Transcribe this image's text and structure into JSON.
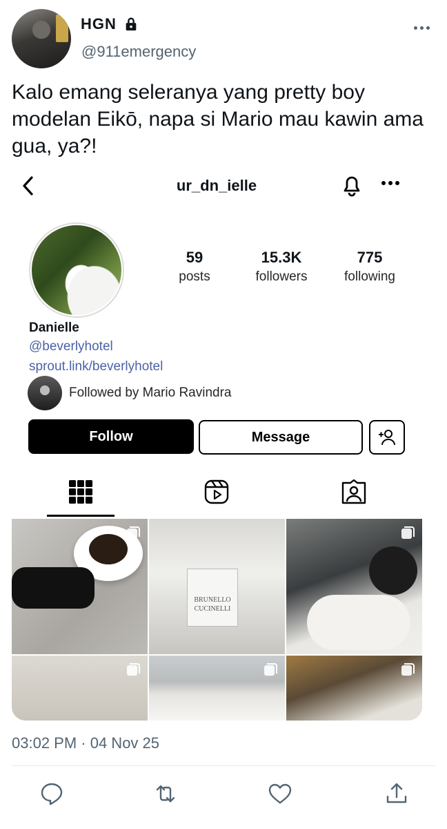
{
  "tweet": {
    "author_name": "HGN",
    "author_handle": "@911emergency",
    "text": "Kalo emang seleranya yang pretty boy modelan Eikō, napa si Mario mau kawin ama gua, ya?!",
    "timestamp": "03:02 PM · 04 Nov 25"
  },
  "instagram": {
    "username": "ur_dn_ielle",
    "stats": {
      "posts_value": "59",
      "posts_label": "posts",
      "followers_value": "15.3K",
      "followers_label": "followers",
      "following_value": "775",
      "following_label": "following"
    },
    "display_name": "Danielle",
    "handle_link": "@beverlyhotel",
    "site_link": "sprout.link/beverlyhotel",
    "followed_by": "Followed by Mario Ravindra",
    "buttons": {
      "follow": "Follow",
      "message": "Message"
    },
    "grid_sign_text": "BRUNELLO CUCINELLI"
  },
  "colors": {
    "link": "#4a63a8",
    "secondary_text": "#536471",
    "follow_button": "#000000"
  }
}
